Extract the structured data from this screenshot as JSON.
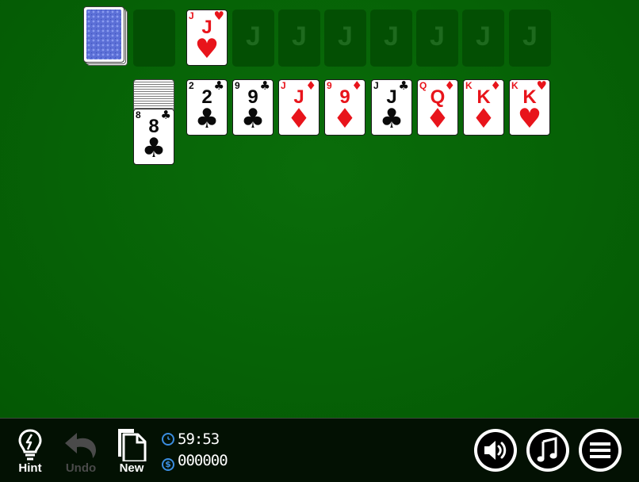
{
  "game": {
    "stock": {
      "face": "down"
    },
    "waste": {
      "empty": true
    },
    "foundations": [
      {
        "rank": "J",
        "suit": "♥",
        "color": "red",
        "center": "♥",
        "placeholder": "J"
      },
      {
        "rank": "",
        "suit": "",
        "placeholder": "J"
      },
      {
        "rank": "",
        "suit": "",
        "placeholder": "J"
      },
      {
        "rank": "",
        "suit": "",
        "placeholder": "J"
      },
      {
        "rank": "",
        "suit": "",
        "placeholder": "J"
      },
      {
        "rank": "",
        "suit": "",
        "placeholder": "J"
      },
      {
        "rank": "",
        "suit": "",
        "placeholder": "J"
      },
      {
        "rank": "",
        "suit": "",
        "placeholder": "J"
      }
    ],
    "reserve": {
      "rank": "8",
      "suit": "♣",
      "color": "black"
    },
    "tableau": [
      {
        "rank": "2",
        "suit": "♣",
        "color": "black"
      },
      {
        "rank": "9",
        "suit": "♣",
        "color": "black"
      },
      {
        "rank": "J",
        "suit": "♦",
        "color": "red"
      },
      {
        "rank": "9",
        "suit": "♦",
        "color": "red"
      },
      {
        "rank": "J",
        "suit": "♣",
        "color": "black"
      },
      {
        "rank": "Q",
        "suit": "♦",
        "color": "red"
      },
      {
        "rank": "K",
        "suit": "♦",
        "color": "red"
      },
      {
        "rank": "K",
        "suit": "♥",
        "color": "red"
      }
    ]
  },
  "toolbar": {
    "hint_label": "Hint",
    "undo_label": "Undo",
    "new_label": "New",
    "timer": "59:53",
    "score": "000000",
    "icons": {
      "hint": "lightbulb-icon",
      "undo": "undo-arrow-icon",
      "new": "new-document-icon",
      "timer": "clock-icon",
      "score": "dollar-icon",
      "sound": "speaker-icon",
      "music": "music-note-icon",
      "menu": "hamburger-menu-icon"
    }
  },
  "colors": {
    "felt": "#066206",
    "toolbar": "#031103",
    "red_suit": "#e8141b",
    "black_suit": "#0a0a0a",
    "stat_icon": "#3b8de0",
    "disabled": "#4a4a4a"
  }
}
